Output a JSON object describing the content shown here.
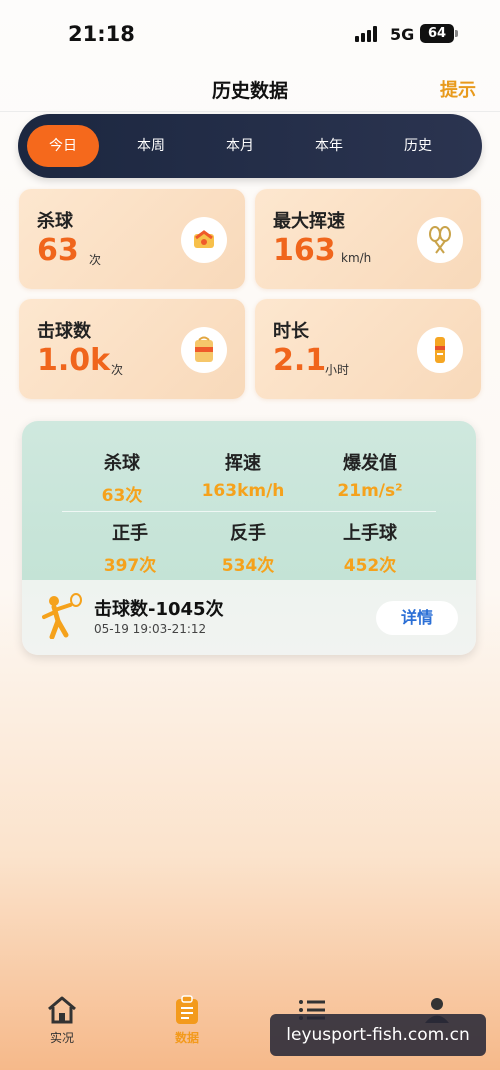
{
  "status_bar": {
    "time": "21:18",
    "network": "5G",
    "battery": "64"
  },
  "header": {
    "title": "历史数据",
    "hint": "提示"
  },
  "period_tabs": [
    {
      "label": "今日",
      "active": true
    },
    {
      "label": "本周",
      "active": false
    },
    {
      "label": "本月",
      "active": false
    },
    {
      "label": "本年",
      "active": false
    },
    {
      "label": "历史",
      "active": false
    }
  ],
  "stat_cards": [
    {
      "label": "杀球",
      "value": "63",
      "unit": "次",
      "icon": "smash-icon"
    },
    {
      "label": "最大挥速",
      "value": "163",
      "unit": "km/h",
      "icon": "rackets-icon"
    },
    {
      "label": "击球数",
      "value": "1.0k",
      "unit": "次",
      "icon": "shuttle-box-icon"
    },
    {
      "label": "时长",
      "value": "2.1",
      "unit": "小时",
      "icon": "timer-icon"
    }
  ],
  "session": {
    "metrics_row1": [
      {
        "label": "杀球",
        "value": "63次"
      },
      {
        "label": "挥速",
        "value": "163km/h"
      },
      {
        "label": "爆发值",
        "value": "21m/s²"
      }
    ],
    "metrics_row2": [
      {
        "label": "正手",
        "value": "397次"
      },
      {
        "label": "反手",
        "value": "534次"
      },
      {
        "label": "上手球",
        "value": "452次"
      }
    ],
    "title": "击球数-1045次",
    "time_range": "05-19 19:03-21:12",
    "details_label": "详情"
  },
  "bottom_nav": [
    {
      "label": "实况",
      "icon": "home-icon",
      "active": false
    },
    {
      "label": "数据",
      "icon": "clipboard-icon",
      "active": true
    },
    {
      "label": "",
      "icon": "list-icon",
      "active": false
    },
    {
      "label": "",
      "icon": "user-icon",
      "active": false
    }
  ],
  "watermark": "leyusport-fish.com.cn",
  "colors": {
    "accent": "#f5691c",
    "value_orange": "#f0651c",
    "metric_yellow": "#f5a21c",
    "tab_bar": "#1c2740",
    "link_blue": "#2b6fd6"
  }
}
